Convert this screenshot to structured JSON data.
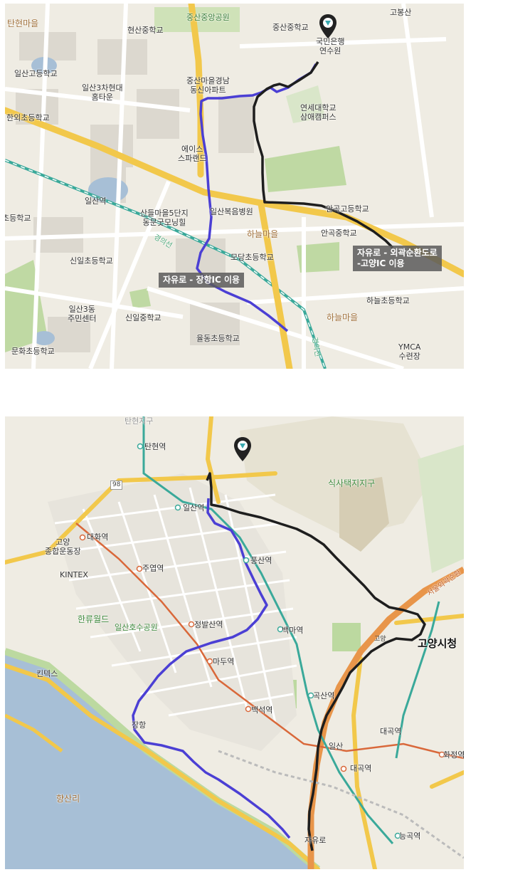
{
  "map1": {
    "labels": {
      "tanhyeon": "탄현마을",
      "jungsan_park": "중산중앙공원",
      "gobongsan": "고봉산",
      "hyeonsan_ms": "현산중학교",
      "jungsan_school": "중산중학교",
      "kb_line1": "국민은행",
      "kb_line2": "연수원",
      "ilsan_hs": "일산고등학교",
      "hyundai_line1": "일산3차현대",
      "hyundai_line2": "홈타운",
      "jungsan_apt_line1": "중산마을경남",
      "jungsan_apt_line2": "동신아파트",
      "yonsei_line1": "연세대학교",
      "yonsei_line2": "삼애캠퍼스",
      "hanoe_es": "한외초등학교",
      "aces_line1": "에이스",
      "aces_line2": "스파랜드",
      "ilsan_station": "일산역",
      "sandeul_line1": "산들마을5단지",
      "sandeul_line2": "동문굿모닝힐",
      "ilsan_hospital": "일산복음병원",
      "angok_hs": "안곡고등학교",
      "angok_ms": "안곡중학교",
      "cho_es": "초등학교",
      "haneul_village1": "하늘마을",
      "sinil_es": "신일초등학교",
      "modang_es": "모당초등학교",
      "ilsan3_line1": "일산3동",
      "ilsan3_line2": "주민센터",
      "sinil_ms": "신일중학교",
      "haneul_es": "하늘초등학교",
      "haneul_village2": "하늘마을",
      "yuldong_es": "율동초등학교",
      "munhwa_es": "문화초등학교",
      "ymca_line1": "YMCA",
      "ymca_line2": "수련장",
      "gyeongui1": "경의선",
      "gyeongui2": "경의선"
    },
    "callout_black_line1": "자유로 - 외곽순환도로",
    "callout_black_line2": "-고양IC 이용",
    "callout_blue": "자유로 - 장항IC 이용"
  },
  "map2": {
    "labels": {
      "tanhyeon_station": "탄현역",
      "ilsan_station": "일산역",
      "sigsa": "식사택지지구",
      "daehwa_station": "대화역",
      "goyang_line1": "고양",
      "goyang_line2": "종합운동장",
      "pungsan_station": "풍산역",
      "juyeop_station": "주엽역",
      "kintex": "KINTEX",
      "hallyu_world": "한류월드",
      "lake_park": "일산호수공원",
      "jeongbalsan_station": "정발산역",
      "baekma_station": "백마역",
      "goyang_ic": "고양",
      "goyang_city": "고양시청",
      "madu_station": "마두역",
      "kintex_ic": "킨텍스",
      "baekseok_station": "백석역",
      "goksan_station": "곡산역",
      "daegok_station2": "대곡역",
      "janghang_ic": "장항",
      "ilsan_ic": "일산",
      "hwajeong_station": "화정역",
      "daegok_station": "대곡역",
      "hangsanri": "향산리",
      "jayuro_jc": "자유로",
      "neunggok_station": "능곡역",
      "route98": "98",
      "seoul_ring": "서울외곽순환",
      "tanhyeon_top": "탄현지구"
    }
  },
  "colors": {
    "route_blue": "#4b3fd4",
    "route_black": "#1e1e1e",
    "highway_yellow": "#f2c84b",
    "expressway_orange": "#e8954a",
    "subway_orange": "#d9683a",
    "rail_teal": "#3aa99a",
    "river": "#a7bfd6",
    "park_green": "#bcd9a0"
  }
}
